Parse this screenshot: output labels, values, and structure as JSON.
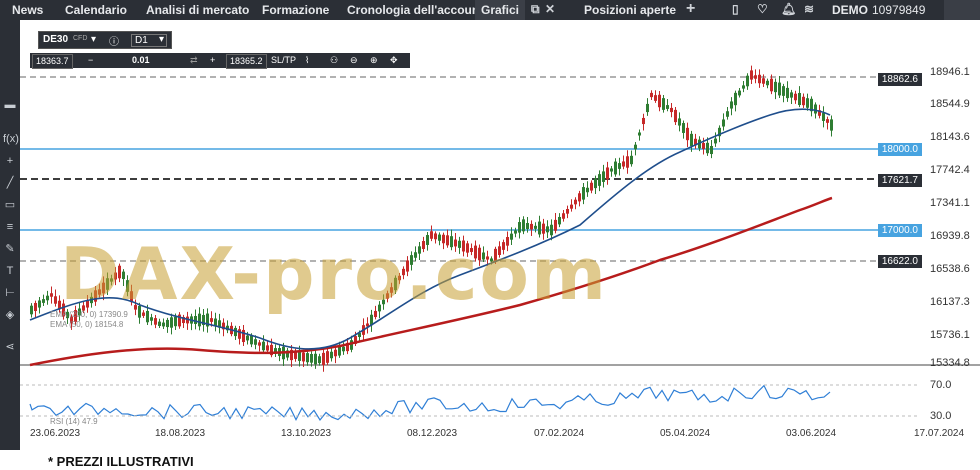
{
  "topbar": {
    "tabs": [
      "News",
      "Calendario",
      "Analisi di mercato",
      "Formazione",
      "Cronologia dell'account",
      "Grafici",
      "Posizioni aperte"
    ],
    "active_tab": "Grafici",
    "account_mode": "DEMO",
    "account_number": "10979849"
  },
  "instrument": {
    "symbol": "DE30",
    "type": "CFD",
    "timeframe": "D1",
    "bid": "18363.7",
    "volume": "0.01",
    "ask": "18365.2",
    "sltp": "SL/TP"
  },
  "price_levels": [
    {
      "label": "18862.6",
      "style": "dashed"
    },
    {
      "label": "18000.0",
      "style": "solid-blue"
    },
    {
      "label": "17621.7",
      "style": "dashed"
    },
    {
      "label": "17000.0",
      "style": "solid-blue"
    },
    {
      "label": "16622.0",
      "style": "dashed"
    }
  ],
  "y_axis": [
    "18946.1",
    "18544.9",
    "18143.6",
    "17742.4",
    "17341.1",
    "16939.8",
    "16538.6",
    "16137.3",
    "15736.1",
    "15334.8"
  ],
  "oscillator_axis": [
    "70.0",
    "30.0"
  ],
  "x_axis": [
    "23.06.2023",
    "18.08.2023",
    "13.10.2023",
    "08.12.2023",
    "07.02.2024",
    "05.04.2024",
    "03.06.2024",
    "17.07.2024"
  ],
  "legend": {
    "ema200": "EMA (200, 0) 17390.9",
    "ema50": "EMA (50, 0) 18154.8",
    "rsi": "RSI (14) 47.9"
  },
  "watermark": "DAX-pro.com",
  "footer_note": "* PREZZI ILLUSTRATIVI",
  "colors": {
    "up_candle": "#2e7d32",
    "down_candle": "#c62828",
    "ema50": "#1f4e8c",
    "ema200": "#b71c1c",
    "rsi_line": "#2f7fd6",
    "level_blue": "#47a3e0"
  }
}
